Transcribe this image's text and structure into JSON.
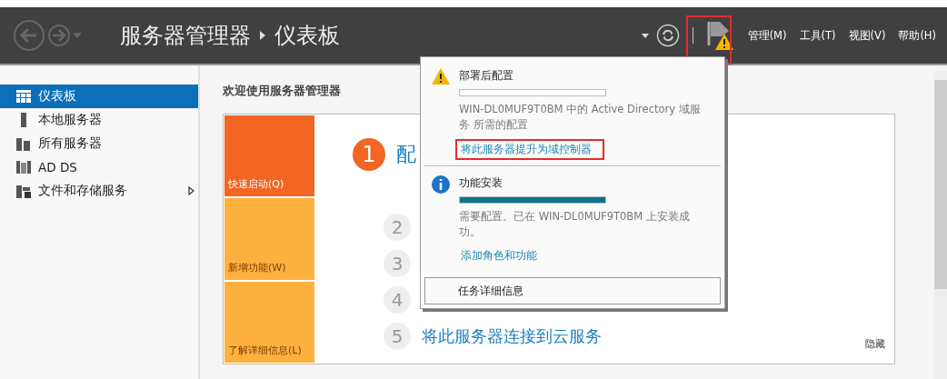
{
  "header": {
    "breadcrumb": [
      "服务器管理器",
      "仪表板"
    ],
    "menus": [
      "管理(M)",
      "工具(T)",
      "视图(V)",
      "帮助(H)"
    ]
  },
  "sidebar": {
    "items": [
      {
        "label": "仪表板",
        "kind": "dashboard",
        "selected": true,
        "submenu": false
      },
      {
        "label": "本地服务器",
        "kind": "server",
        "selected": false,
        "submenu": false
      },
      {
        "label": "所有服务器",
        "kind": "servers",
        "selected": false,
        "submenu": false
      },
      {
        "label": "AD DS",
        "kind": "adds",
        "selected": false,
        "submenu": false
      },
      {
        "label": "文件和存储服务",
        "kind": "files",
        "selected": false,
        "submenu": true
      }
    ]
  },
  "welcome": {
    "title": "欢迎使用服务器管理器",
    "tiles": [
      {
        "label": "快速启动(Q)",
        "selected": true
      },
      {
        "label": "新增功能(W)",
        "selected": false
      },
      {
        "label": "了解详细信息(L)",
        "selected": false
      }
    ],
    "steps": [
      {
        "number": "1",
        "text": "配",
        "selected": true
      },
      {
        "number": "2",
        "selected": false
      },
      {
        "number": "3",
        "selected": false
      },
      {
        "number": "4",
        "selected": false
      },
      {
        "number": "5",
        "text": "将此服务器连接到云服务",
        "selected": false
      }
    ],
    "hide": "隐藏"
  },
  "notifications": {
    "items": [
      {
        "kind": "warning",
        "title": "部署后配置",
        "level": 0,
        "message": "WIN-DL0MUF9T0BM 中的 Active Directory 域服务 所需的配置",
        "link": "将此服务器提升为域控制器",
        "highlighted": true
      },
      {
        "kind": "info",
        "title": "功能安装",
        "level": 1,
        "message": "需要配置。已在 WIN-DL0MUF9T0BM 上安装成功。",
        "link": "添加角色和功能",
        "highlighted": false
      }
    ],
    "details": "任务详细信息"
  }
}
